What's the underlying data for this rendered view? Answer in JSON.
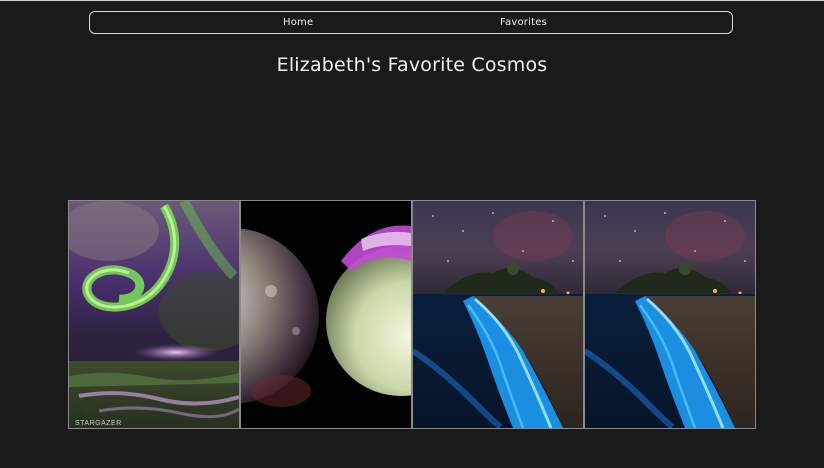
{
  "nav": {
    "home_label": "Home",
    "favorites_label": "Favorites"
  },
  "page": {
    "title": "Elizabeth's Favorite Cosmos"
  },
  "gallery": {
    "images": [
      {
        "subject": "aurora-over-wetland-photo",
        "watermark": "STARGAZER"
      },
      {
        "subject": "two-planets-photo"
      },
      {
        "subject": "bioluminescent-beach-night-photo"
      },
      {
        "subject": "bioluminescent-beach-night-photo"
      }
    ]
  },
  "colors": {
    "background": "#1a1a1a",
    "nav_border": "#d8d8d8",
    "text": "#f0f0f0"
  }
}
